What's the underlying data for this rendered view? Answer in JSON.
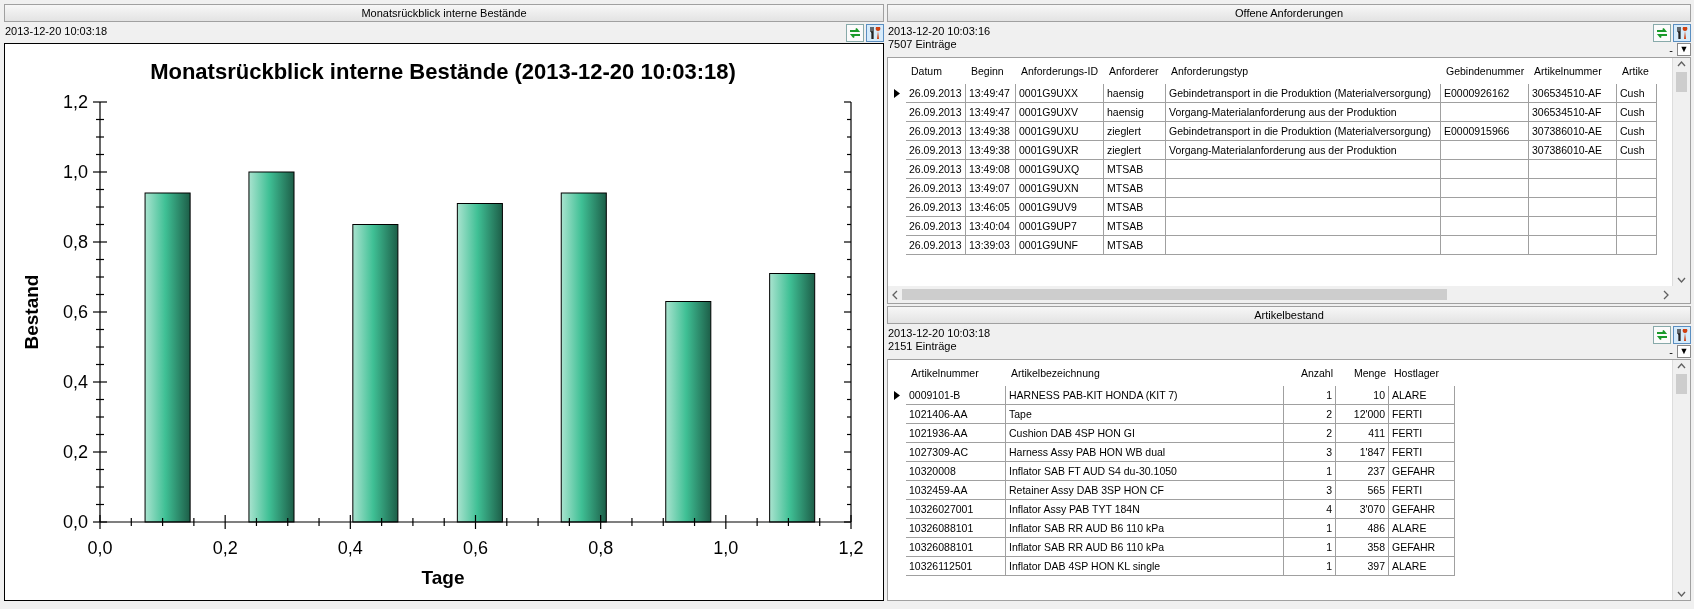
{
  "chart_panel": {
    "title": "Monatsrückblick interne Bestände",
    "timestamp": "2013-12-20 10:03:18",
    "chart_data": {
      "type": "bar",
      "title": "Monatsrückblick interne Bestände (2013-12-20 10:03:18)",
      "xlabel": "Tage",
      "ylabel": "Bestand",
      "x": [
        0.108,
        0.274,
        0.44,
        0.607,
        0.773,
        0.94,
        1.106
      ],
      "values": [
        0.94,
        1.0,
        0.85,
        0.91,
        0.94,
        0.63,
        0.71
      ],
      "xlim": [
        0,
        1.2
      ],
      "ylim": [
        0,
        1.2
      ],
      "xticks": [
        {
          "value": 0,
          "label": "0,0"
        },
        {
          "value": 0.2,
          "label": "0,2"
        },
        {
          "value": 0.4,
          "label": "0,4"
        },
        {
          "value": 0.6,
          "label": "0,6"
        },
        {
          "value": 0.8,
          "label": "0,8"
        },
        {
          "value": 1.0,
          "label": "1,0"
        },
        {
          "value": 1.2,
          "label": "1,2"
        }
      ],
      "yticks": [
        {
          "value": 0,
          "label": "0,0"
        },
        {
          "value": 0.2,
          "label": "0,2"
        },
        {
          "value": 0.4,
          "label": "0,4"
        },
        {
          "value": 0.6,
          "label": "0,6"
        },
        {
          "value": 0.8,
          "label": "0,8"
        },
        {
          "value": 1.0,
          "label": "1,0"
        },
        {
          "value": 1.2,
          "label": "1,2"
        }
      ]
    }
  },
  "requests_panel": {
    "title": "Offene Anforderungen",
    "timestamp": "2013-12-20 10:03:16",
    "count": "7507 Einträge",
    "collapse": "-",
    "dropdown": "▼",
    "columns": [
      {
        "label": "Datum",
        "kind": "text"
      },
      {
        "label": "Beginn",
        "kind": "text"
      },
      {
        "label": "Anforderungs-ID",
        "kind": "text"
      },
      {
        "label": "Anforderer",
        "kind": "text"
      },
      {
        "label": "Anforderungstyp",
        "kind": "text"
      },
      {
        "label": "Gebindenummer",
        "kind": "text"
      },
      {
        "label": "Artikelnummer",
        "kind": "text"
      },
      {
        "label": "Artike",
        "kind": "text"
      }
    ],
    "rows": [
      {
        "selected": true,
        "cells": [
          "26.09.2013",
          "13:49:47",
          "0001G9UXX",
          "haensig",
          "Gebindetransport in die Produktion (Materialversorgung)",
          "E0000926162",
          "306534510-AF",
          "Cush"
        ]
      },
      {
        "selected": false,
        "cells": [
          "26.09.2013",
          "13:49:47",
          "0001G9UXV",
          "haensig",
          "Vorgang-Materialanforderung aus der Produktion",
          "",
          "306534510-AF",
          "Cush"
        ]
      },
      {
        "selected": false,
        "cells": [
          "26.09.2013",
          "13:49:38",
          "0001G9UXU",
          "zieglert",
          "Gebindetransport in die Produktion (Materialversorgung)",
          "E0000915966",
          "307386010-AE",
          "Cush"
        ]
      },
      {
        "selected": false,
        "cells": [
          "26.09.2013",
          "13:49:38",
          "0001G9UXR",
          "zieglert",
          "Vorgang-Materialanforderung aus der Produktion",
          "",
          "307386010-AE",
          "Cush"
        ]
      },
      {
        "selected": false,
        "cells": [
          "26.09.2013",
          "13:49:08",
          "0001G9UXQ",
          "MTSAB",
          "",
          "",
          "",
          ""
        ]
      },
      {
        "selected": false,
        "cells": [
          "26.09.2013",
          "13:49:07",
          "0001G9UXN",
          "MTSAB",
          "",
          "",
          "",
          ""
        ]
      },
      {
        "selected": false,
        "cells": [
          "26.09.2013",
          "13:46:05",
          "0001G9UV9",
          "MTSAB",
          "",
          "",
          "",
          ""
        ]
      },
      {
        "selected": false,
        "cells": [
          "26.09.2013",
          "13:40:04",
          "0001G9UP7",
          "MTSAB",
          "",
          "",
          "",
          ""
        ]
      },
      {
        "selected": false,
        "cells": [
          "26.09.2013",
          "13:39:03",
          "0001G9UNF",
          "MTSAB",
          "",
          "",
          "",
          ""
        ]
      }
    ]
  },
  "stock_panel": {
    "title": "Artikelbestand",
    "timestamp": "2013-12-20 10:03:18",
    "count": "2151 Einträge",
    "collapse": "-",
    "dropdown": "▼",
    "columns": [
      {
        "label": "Artikelnummer",
        "kind": "text"
      },
      {
        "label": "Artikelbezeichnung",
        "kind": "text"
      },
      {
        "label": "Anzahl",
        "kind": "number"
      },
      {
        "label": "Menge",
        "kind": "number"
      },
      {
        "label": "Hostlager",
        "kind": "text"
      }
    ],
    "rows": [
      {
        "selected": true,
        "cells": [
          "0009101-B",
          "HARNESS PAB-KIT HONDA (KIT 7)",
          "1",
          "10",
          "ALARE"
        ]
      },
      {
        "selected": false,
        "cells": [
          "1021406-AA",
          "Tape",
          "2",
          "12'000",
          "FERTI"
        ]
      },
      {
        "selected": false,
        "cells": [
          "1021936-AA",
          "Cushion DAB 4SP HON GI",
          "2",
          "411",
          "FERTI"
        ]
      },
      {
        "selected": false,
        "cells": [
          "1027309-AC",
          "Harness Assy PAB HON WB dual",
          "3",
          "1'847",
          "FERTI"
        ]
      },
      {
        "selected": false,
        "cells": [
          "10320008",
          "Inflator SAB FT AUD S4 du-30.1050",
          "1",
          "237",
          "GEFAHR"
        ]
      },
      {
        "selected": false,
        "cells": [
          "1032459-AA",
          "Retainer Assy DAB 3SP HON CF",
          "3",
          "565",
          "FERTI"
        ]
      },
      {
        "selected": false,
        "cells": [
          "10326027001",
          "Inflator Assy PAB TYT 184N",
          "4",
          "3'070",
          "GEFAHR"
        ]
      },
      {
        "selected": false,
        "cells": [
          "10326088101",
          "Inflator SAB RR AUD B6 110 kPa",
          "1",
          "486",
          "ALARE"
        ]
      },
      {
        "selected": false,
        "cells": [
          "10326088101",
          "Inflator SAB RR AUD B6 110 kPa",
          "1",
          "358",
          "GEFAHR"
        ]
      },
      {
        "selected": false,
        "cells": [
          "10326112501",
          "Inflator DAB 4SP HON KL single",
          "1",
          "397",
          "ALARE"
        ]
      }
    ]
  }
}
